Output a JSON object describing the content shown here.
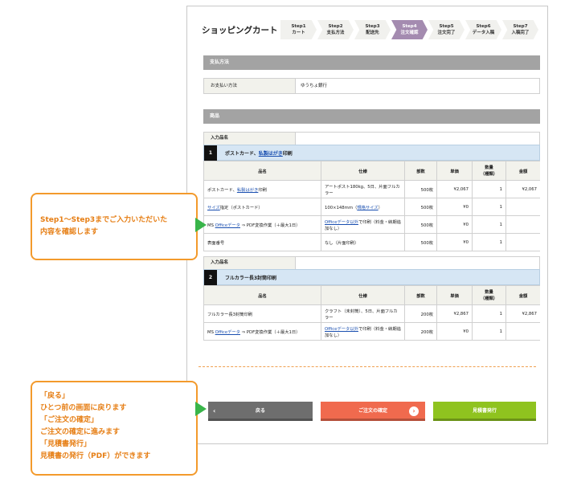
{
  "header": {
    "title": "ショッピングカート",
    "steps": [
      {
        "num": "Step1",
        "label": "カート"
      },
      {
        "num": "Step2",
        "label": "支払方法"
      },
      {
        "num": "Step3",
        "label": "配送先"
      },
      {
        "num": "Step4",
        "label": "注文確認"
      },
      {
        "num": "Step5",
        "label": "注文完了"
      },
      {
        "num": "Step6",
        "label": "データ入稿"
      },
      {
        "num": "Step7",
        "label": "入稿完了"
      }
    ]
  },
  "payment": {
    "section_title": "支払方法",
    "label": "お支払い方法",
    "value": "ゆうちょ銀行"
  },
  "products": {
    "section_title": "商品",
    "columns": [
      "品名",
      "仕様",
      "部数",
      "単価",
      "数量\n（種類）",
      "金額"
    ],
    "items": [
      {
        "name_label": "入力品名",
        "num": "1",
        "title_prefix": "ポストカード、",
        "title_link": "私製はがき",
        "title_suffix": "印刷",
        "rows": [
          {
            "a": "ポストカード、",
            "a_link": "私製はがき",
            "a_after": "印刷",
            "spec": "アートポスト180kg、5日、片面フルカラー",
            "qty": "500枚",
            "unit": "¥2,067",
            "count": "1",
            "amount": "¥2,067"
          },
          {
            "a_link": "サイズ",
            "a_after": "指定（ポストカード）",
            "spec": "100×148mm（",
            "spec_link": "規格サイズ",
            "spec_after": "）",
            "qty": "500枚",
            "unit": "¥0",
            "count": "1",
            "amount": ""
          },
          {
            "a": "MS ",
            "a_link": "Officeデータ",
            "a_after": " ⇒ PDF変換作業（＋最大1日）",
            "spec_link": "Officeデータ以外",
            "spec_after": "で印刷（料金・納期追加なし）",
            "qty": "500枚",
            "unit": "¥0",
            "count": "1",
            "amount": ""
          },
          {
            "a": "表面番号",
            "spec": "なし（片面印刷）",
            "qty": "500枚",
            "unit": "¥0",
            "count": "1",
            "amount": ""
          }
        ]
      },
      {
        "name_label": "入力品名",
        "num": "2",
        "title_prefix": "フルカラー長3封筒印刷",
        "rows": [
          {
            "a": "フルカラー長3封筒印刷",
            "spec": "クラフト（未封筒）、5日、片面フルカラー",
            "qty": "200枚",
            "unit": "¥2,867",
            "count": "1",
            "amount": "¥2,867"
          },
          {
            "a": "MS ",
            "a_link": "Officeデータ",
            "a_after": " ⇒ PDF変換作業（＋最大1日）",
            "spec_link": "Officeデータ以外",
            "spec_after": "で印刷（料金・納期追加なし）",
            "qty": "200枚",
            "unit": "¥0",
            "count": "1",
            "amount": ""
          }
        ]
      }
    ]
  },
  "buttons": {
    "back": "戻る",
    "confirm": "ご注文の確定",
    "quote": "見積書発行"
  },
  "callouts": {
    "first": [
      "Step1〜Step3までご入力いただいた",
      "内容を確認します"
    ],
    "second": [
      "「戻る」",
      "ひとつ前の画面に戻ります",
      "「ご注文の確定」",
      "ご注文の確定に進みます",
      "「見積書発行」",
      "見積書の発行（PDF）ができます"
    ]
  },
  "colors": {
    "active_step": "#a48bb0",
    "back_button": "#6e6e6e",
    "confirm_button": "#f06a4e",
    "quote_button": "#8fc31f",
    "callout_border": "#f39a2c",
    "arrow": "#39b54a"
  }
}
